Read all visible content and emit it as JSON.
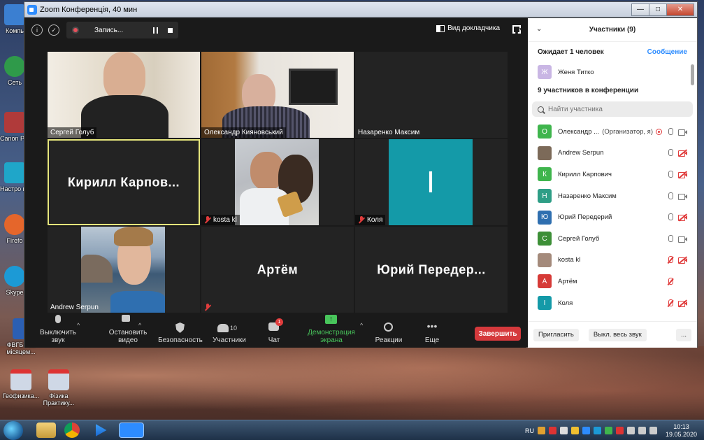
{
  "desktop": {
    "icons": [
      {
        "label": "Компь",
        "color": "#3b7fd1"
      },
      {
        "label": "Сеть",
        "color": "#2f9a4a"
      },
      {
        "label": "Canon Power",
        "color": "#b03a3a"
      },
      {
        "label": "Настро камер",
        "color": "#1fa6c9"
      },
      {
        "label": "Firefo",
        "color": "#e5662b"
      },
      {
        "label": "Skype",
        "color": "#1c9ad6"
      },
      {
        "label": "ФВГБЗ за місяцем...",
        "color": "#2b5fb3"
      },
      {
        "label": "Геофизика...",
        "color": "#cfd8e6"
      },
      {
        "label": "Фізика Практику...",
        "color": "#cfd8e6"
      }
    ]
  },
  "window": {
    "title": "Zoom Конференція, 40 мин",
    "min_label": "—",
    "max_label": "□",
    "close_label": "✕"
  },
  "topbar": {
    "info_label": "i",
    "shield_label": "✓",
    "recording_label": "Запись...",
    "speaker_view_label": "Вид докладчика"
  },
  "tiles": [
    {
      "name": "Сергей Голуб",
      "show_video": true,
      "muted": false
    },
    {
      "name": "Олександр Кияновський",
      "show_video": true,
      "muted": false
    },
    {
      "name": "Назаренко Максим",
      "show_video": false,
      "muted": false
    },
    {
      "name": "Кирилл  Карпов...",
      "show_video": false,
      "muted": false,
      "active": true
    },
    {
      "name": "kosta kl",
      "show_video": true,
      "muted": true
    },
    {
      "name": "Коля",
      "show_video": false,
      "muted": true,
      "avatar_letter": "I"
    },
    {
      "name": "Andrew Serpun",
      "show_video": true,
      "muted": false
    },
    {
      "name": "Артём",
      "show_video": false,
      "muted": true
    },
    {
      "name": "Юрий  Передер...",
      "show_video": false,
      "muted": false
    }
  ],
  "toolbar": {
    "mute_label": "Выключить звук",
    "video_label": "Остановить видео",
    "security_label": "Безопасность",
    "participants_label": "Участники",
    "participants_count": "10",
    "chat_label": "Чат",
    "chat_badge": "1",
    "share_label": "Демонстрация экрана",
    "reactions_label": "Реакции",
    "more_label": "Еще",
    "end_label": "Завершить"
  },
  "panel": {
    "title": "Участники (9)",
    "waiting_label": "Ожидает 1 человек",
    "message_link": "Сообщение",
    "waiting_person": {
      "name": "Женя Титко",
      "initial": "Ж",
      "color": "#c9b6e4"
    },
    "in_meeting_label": "9 участников в конференции",
    "search_placeholder": "Найти участника",
    "participants": [
      {
        "name": "Олександр ...",
        "role": "(Организатор, я)",
        "initial": "О",
        "color": "#3fb54d",
        "mic": "on",
        "cam": "on",
        "rec": true
      },
      {
        "name": "Andrew Serpun",
        "role": "",
        "initial": "",
        "color": "#7c6a59",
        "mic": "on",
        "cam": "off",
        "rec": false
      },
      {
        "name": "Кирилл Карпович",
        "role": "",
        "initial": "К",
        "color": "#3fb54d",
        "mic": "on",
        "cam": "off",
        "rec": false
      },
      {
        "name": "Назаренко Максим",
        "role": "",
        "initial": "Н",
        "color": "#2e9e86",
        "mic": "on",
        "cam": "on",
        "rec": false
      },
      {
        "name": "Юрий Передерий",
        "role": "",
        "initial": "Ю",
        "color": "#2f6fb0",
        "mic": "on",
        "cam": "off",
        "rec": false
      },
      {
        "name": "Сергей Голуб",
        "role": "",
        "initial": "С",
        "color": "#3d8f37",
        "mic": "on",
        "cam": "on",
        "rec": false
      },
      {
        "name": "kosta kl",
        "role": "",
        "initial": "",
        "color": "#a48a7b",
        "mic": "off",
        "cam": "off",
        "rec": false
      },
      {
        "name": "Артём",
        "role": "",
        "initial": "А",
        "color": "#d63a37",
        "mic": "off",
        "cam": "none",
        "rec": false
      },
      {
        "name": "Коля",
        "role": "",
        "initial": "I",
        "color": "#149aa8",
        "mic": "off",
        "cam": "off",
        "rec": false
      }
    ],
    "invite_label": "Пригласить",
    "mute_all_label": "Выкл. весь звук",
    "more_label": "..."
  },
  "taskbar": {
    "lang": "RU",
    "time": "10:13",
    "date": "19.05.2020"
  }
}
